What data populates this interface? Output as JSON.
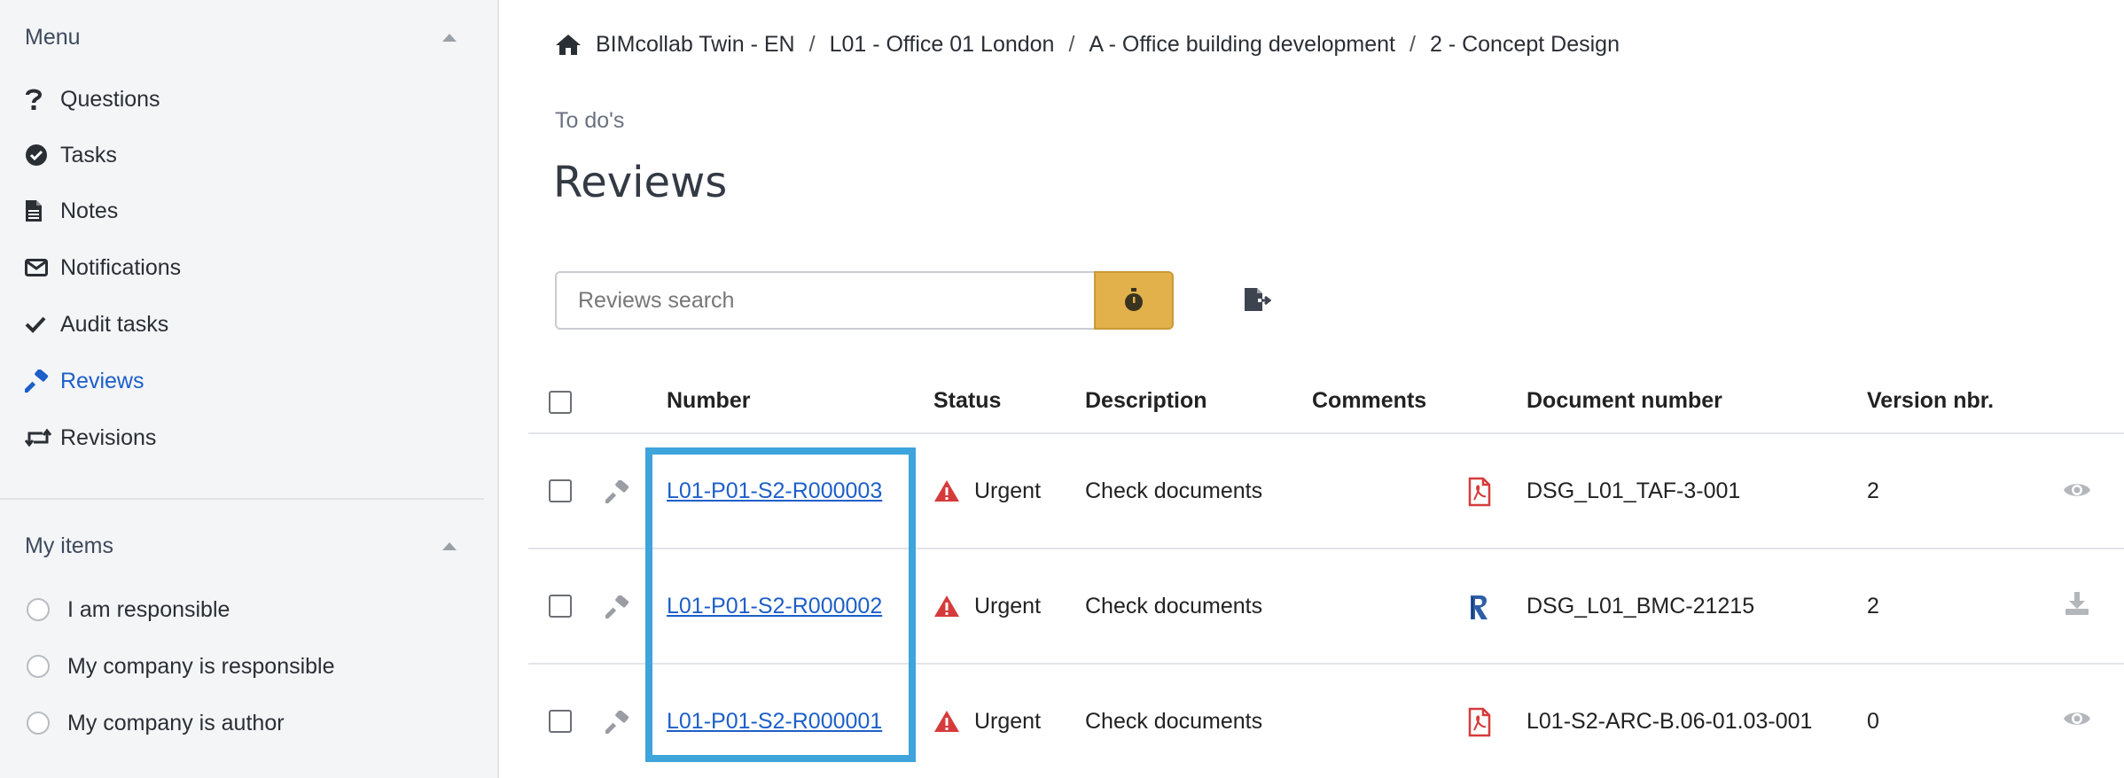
{
  "sidebar": {
    "menu_title": "Menu",
    "items": [
      {
        "label": "Questions",
        "icon": "question-icon"
      },
      {
        "label": "Tasks",
        "icon": "check-circle-icon"
      },
      {
        "label": "Notes",
        "icon": "document-icon"
      },
      {
        "label": "Notifications",
        "icon": "envelope-icon"
      },
      {
        "label": "Audit tasks",
        "icon": "checkmark-icon"
      },
      {
        "label": "Reviews",
        "icon": "hammer-icon",
        "active": true
      },
      {
        "label": "Revisions",
        "icon": "retweet-icon"
      }
    ],
    "my_items_title": "My items",
    "my_items": [
      {
        "label": "I am responsible"
      },
      {
        "label": "My company is responsible"
      },
      {
        "label": "My company is author"
      }
    ]
  },
  "breadcrumb": [
    "BIMcollab Twin - EN",
    "L01 - Office 01 London",
    "A - Office building development",
    "2 - Concept Design"
  ],
  "subtitle": "To do's",
  "title": "Reviews",
  "search": {
    "placeholder": "Reviews search"
  },
  "table": {
    "headers": {
      "number": "Number",
      "status": "Status",
      "description": "Description",
      "comments": "Comments",
      "document_number": "Document number",
      "version": "Version nbr."
    },
    "rows": [
      {
        "number": "L01-P01-S2-R000003",
        "status": "Urgent",
        "description": "Check documents",
        "file_icon": "pdf-icon",
        "document_number": "DSG_L01_TAF-3-001",
        "version": "2",
        "action_icon": "eye-icon"
      },
      {
        "number": "L01-P01-S2-R000002",
        "status": "Urgent",
        "description": "Check documents",
        "file_icon": "revit-icon",
        "document_number": "DSG_L01_BMC-21215",
        "version": "2",
        "action_icon": "download-icon"
      },
      {
        "number": "L01-P01-S2-R000001",
        "status": "Urgent",
        "description": "Check documents",
        "file_icon": "pdf-icon",
        "document_number": "L01-S2-ARC-B.06-01.03-001",
        "version": "0",
        "action_icon": "eye-icon"
      }
    ]
  },
  "colors": {
    "accent": "#1d5fc9",
    "timer_button": "#e2b14b",
    "highlight": "#3ea4dc",
    "urgent": "#d63b3b"
  }
}
